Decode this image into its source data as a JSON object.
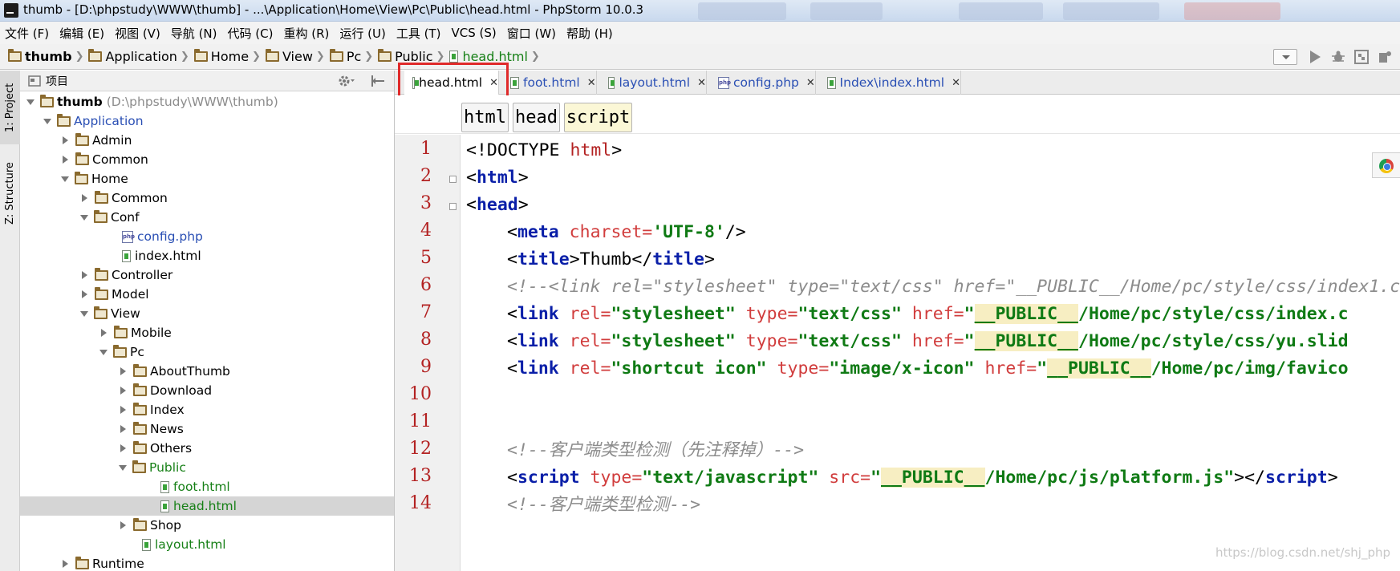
{
  "window": {
    "title": "thumb - [D:\\phpstudy\\WWW\\thumb] - ...\\Application\\Home\\View\\Pc\\Public\\head.html - PhpStorm 10.0.3"
  },
  "menu": [
    "文件 (F)",
    "编辑 (E)",
    "视图 (V)",
    "导航 (N)",
    "代码 (C)",
    "重构 (R)",
    "运行 (U)",
    "工具 (T)",
    "VCS (S)",
    "窗口 (W)",
    "帮助 (H)"
  ],
  "breadcrumb": [
    "thumb",
    "Application",
    "Home",
    "View",
    "Pc",
    "Public",
    "head.html"
  ],
  "side_tabs": {
    "project": "1: Project",
    "structure": "Z: Structure"
  },
  "project_panel": {
    "title": "项目",
    "tree": [
      {
        "label": "thumb",
        "hint": "(D:\\phpstudy\\WWW\\thumb)"
      },
      {
        "label": "Application"
      },
      {
        "label": "Admin"
      },
      {
        "label": "Common"
      },
      {
        "label": "Home"
      },
      {
        "label": "Common"
      },
      {
        "label": "Conf"
      },
      {
        "label": "config.php"
      },
      {
        "label": "index.html"
      },
      {
        "label": "Controller"
      },
      {
        "label": "Model"
      },
      {
        "label": "View"
      },
      {
        "label": "Mobile"
      },
      {
        "label": "Pc"
      },
      {
        "label": "AboutThumb"
      },
      {
        "label": "Download"
      },
      {
        "label": "Index"
      },
      {
        "label": "News"
      },
      {
        "label": "Others"
      },
      {
        "label": "Public"
      },
      {
        "label": "foot.html"
      },
      {
        "label": "head.html"
      },
      {
        "label": "Shop"
      },
      {
        "label": "layout.html"
      },
      {
        "label": "Runtime"
      }
    ]
  },
  "tabs": [
    "head.html",
    "foot.html",
    "layout.html",
    "config.php",
    "Index\\index.html"
  ],
  "tag_path": [
    "html",
    "head",
    "script"
  ],
  "line_numbers": [
    "1",
    "2",
    "3",
    "4",
    "5",
    "6",
    "7",
    "8",
    "9",
    "10",
    "11",
    "12",
    "13",
    "14"
  ],
  "code": {
    "l1": [
      "<!DOCTYPE ",
      "html",
      ">"
    ],
    "l2": [
      "<",
      "html",
      ">"
    ],
    "l3": [
      "<",
      "head",
      ">"
    ],
    "l4": [
      "<",
      "meta",
      " charset=",
      "'UTF-8'",
      "/>"
    ],
    "l5": [
      "<",
      "title",
      ">",
      "Thumb",
      "</",
      "title",
      ">"
    ],
    "l6": "<!--<link rel=\"stylesheet\" type=\"text/css\" href=\"__PUBLIC__/Home/pc/style/css/index1.c",
    "l7": [
      "<",
      "link",
      " rel=",
      "\"stylesheet\"",
      " type=",
      "\"text/css\"",
      " href=",
      "\"",
      "__PUBLIC__",
      "/Home/pc/style/css/index.c"
    ],
    "l8": [
      "<",
      "link",
      " rel=",
      "\"stylesheet\"",
      " type=",
      "\"text/css\"",
      " href=",
      "\"",
      "__PUBLIC__",
      "/Home/pc/style/css/yu.slid"
    ],
    "l9": [
      "<",
      "link",
      " rel=",
      "\"shortcut icon\"",
      " type=",
      "\"image/x-icon\"",
      " href=",
      "\"",
      "__PUBLIC__",
      "/Home/pc/img/favico"
    ],
    "l12": "<!--客户端类型检测（先注释掉）-->",
    "l13": [
      "<",
      "script",
      " type=",
      "\"text/javascript\"",
      " src=",
      "\"",
      "__PUBLIC__",
      "/Home/pc/js/platform.js\"",
      "></",
      "script",
      ">"
    ],
    "l14": "<!--客户端类型检测-->"
  },
  "watermark": "https://blog.csdn.net/shj_php",
  "colors": {
    "tag": "#0a1fa8",
    "attr": "#d13d3d",
    "value": "#0f7a14",
    "comment": "#8c8c8c",
    "highlight_box": "#e02a2a"
  }
}
